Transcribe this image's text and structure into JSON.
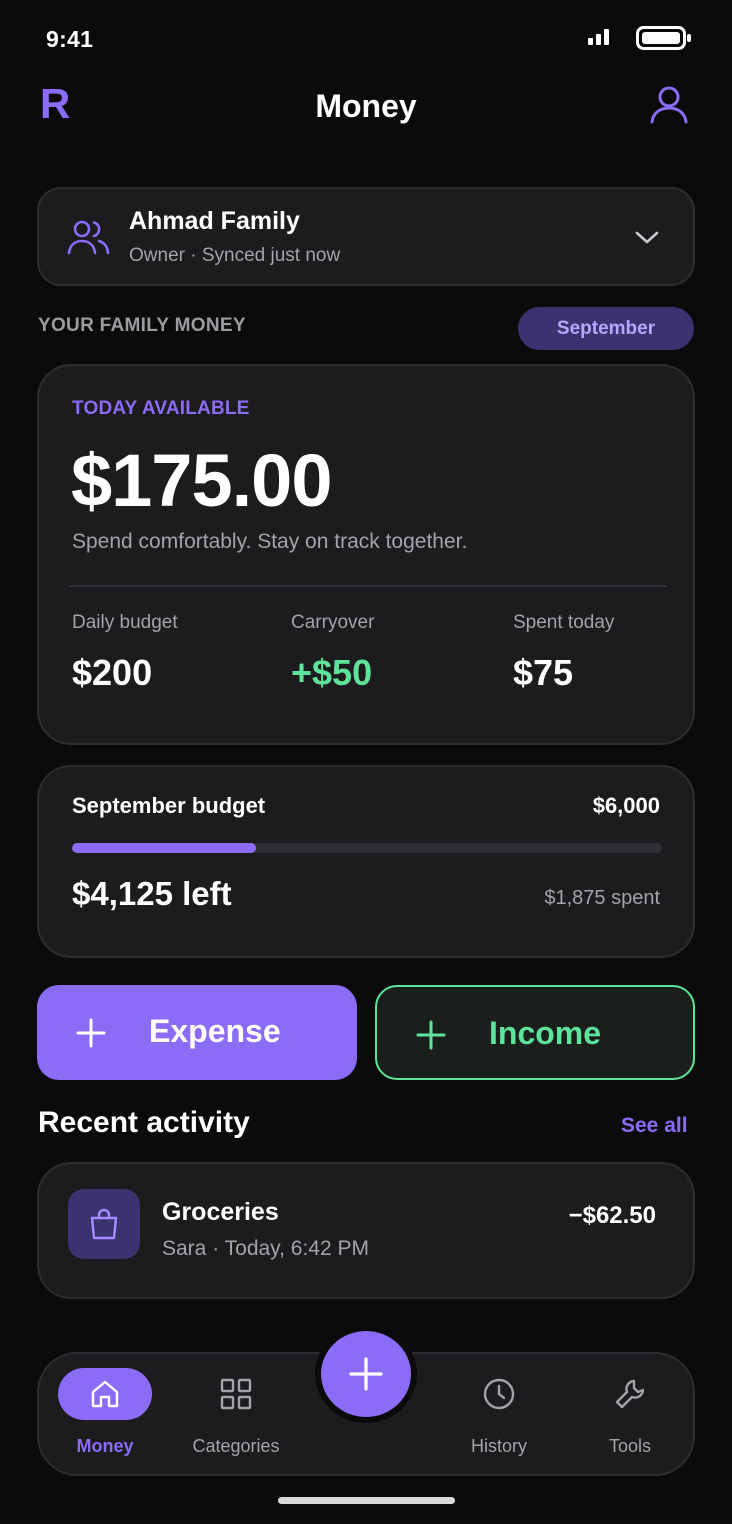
{
  "status_bar": {
    "time": "9:41"
  },
  "header": {
    "logo": "R",
    "title": "Money"
  },
  "family": {
    "name": "Ahmad Family",
    "subtitle": "Owner · Synced just now"
  },
  "section": {
    "label": "YOUR FAMILY MONEY",
    "month": "September"
  },
  "today": {
    "label": "TODAY AVAILABLE",
    "amount": "$175.00",
    "tagline": "Spend comfortably. Stay on track together.",
    "stats": [
      {
        "label": "Daily budget",
        "value": "$200"
      },
      {
        "label": "Carryover",
        "value": "+$50"
      },
      {
        "label": "Spent today",
        "value": "$75"
      }
    ]
  },
  "budget": {
    "title": "September budget",
    "total": "$6,000",
    "left": "$4,125 left",
    "spent": "$1,875 spent",
    "progress_fraction": 0.3125
  },
  "actions": {
    "expense": "Expense",
    "income": "Income"
  },
  "recent": {
    "title": "Recent activity",
    "see_all": "See all",
    "items": [
      {
        "name": "Groceries",
        "meta": "Sara · Today, 6:42 PM",
        "amount": "−$62.50"
      }
    ]
  },
  "nav": {
    "items": [
      {
        "label": "Money",
        "icon": "home-icon",
        "active": true
      },
      {
        "label": "Categories",
        "icon": "grid-icon",
        "active": false
      },
      {
        "label": "History",
        "icon": "clock-icon",
        "active": false
      },
      {
        "label": "Tools",
        "icon": "wrench-icon",
        "active": false
      }
    ],
    "fab_icon": "plus-icon"
  },
  "colors": {
    "accent": "#8b6cf6",
    "positive": "#5ee39a",
    "background": "#0b0b0c",
    "card": "#1c1c1e"
  }
}
